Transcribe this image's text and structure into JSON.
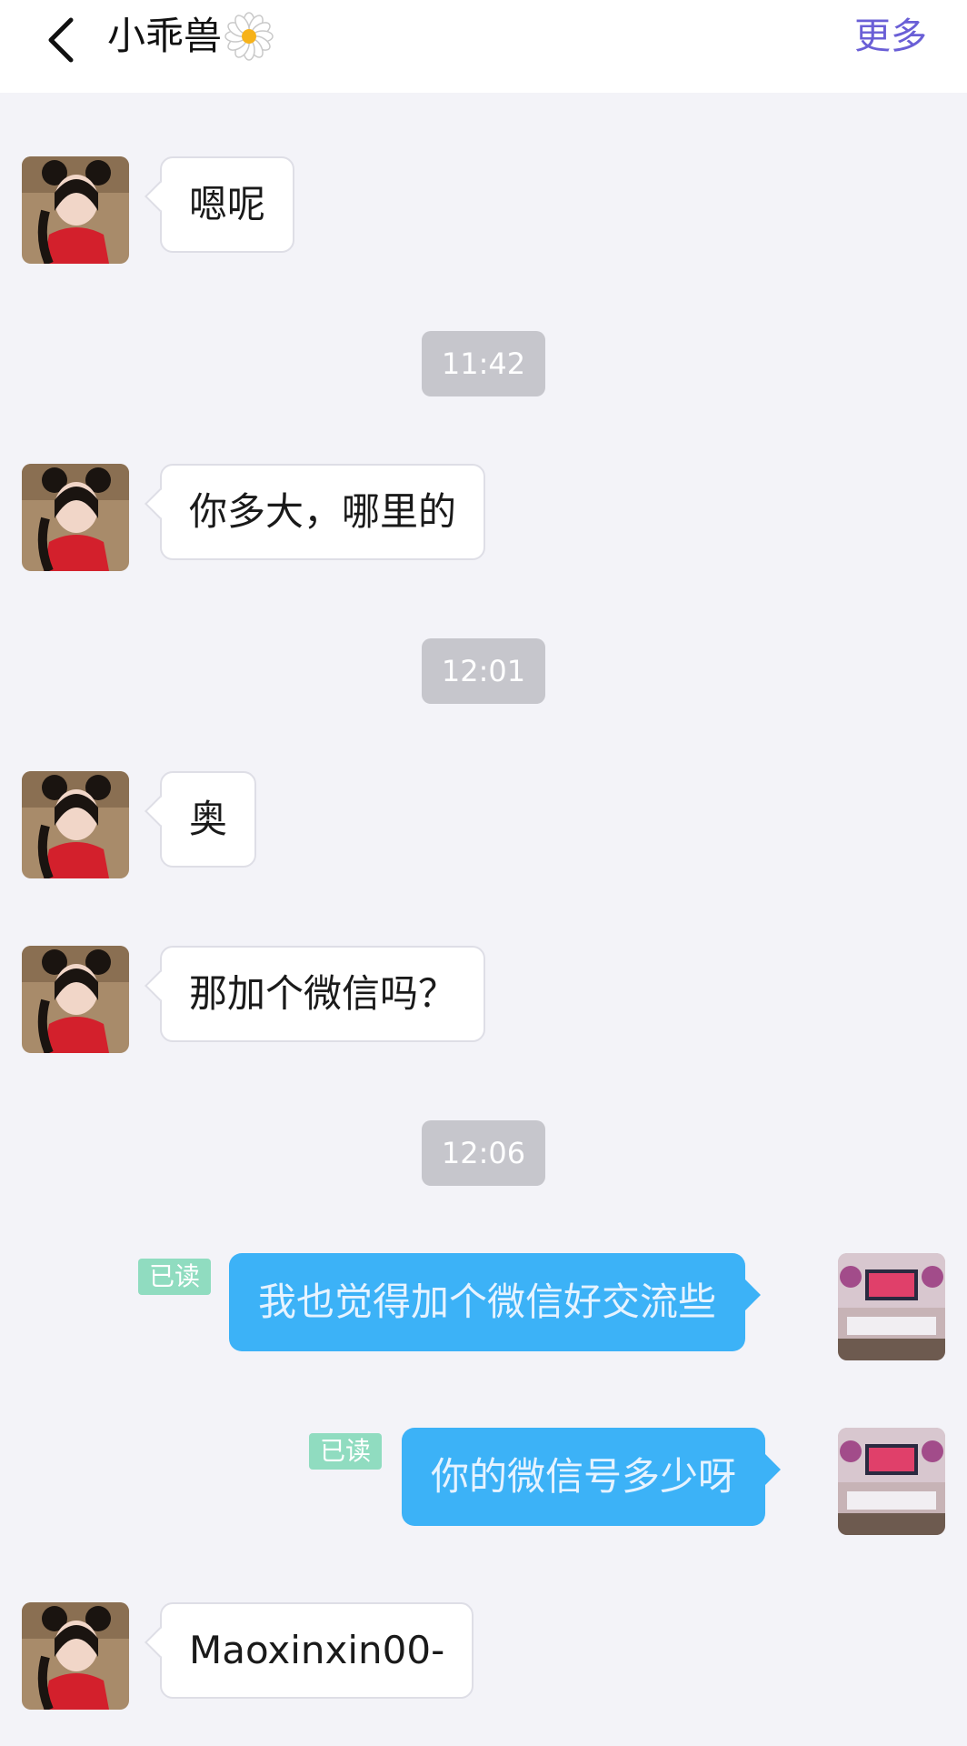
{
  "header": {
    "title": "小乖兽",
    "more_label": "更多",
    "back_icon": "back-arrow-icon",
    "flower_icon": "daisy-icon"
  },
  "messages": [
    {
      "side": "left",
      "text": "嗯呢"
    },
    {
      "time": "11:42"
    },
    {
      "side": "left",
      "text": "你多大，哪里的"
    },
    {
      "time": "12:01"
    },
    {
      "side": "left",
      "text": "奥"
    },
    {
      "side": "left",
      "text": "那加个微信吗？"
    },
    {
      "time": "12:06"
    },
    {
      "side": "right",
      "text": "我也觉得加个微信好交流些",
      "status": "已读"
    },
    {
      "side": "right",
      "text": "你的微信号多少呀",
      "status": "已读"
    },
    {
      "side": "left",
      "text": "Maoxinxin00-"
    }
  ],
  "colors": {
    "accent": "#6a5fd6",
    "outgoing_bubble": "#3cb2f7",
    "read_badge": "#90dcc0",
    "time_badge": "#c6c6cc",
    "background": "#f3f3f8"
  }
}
